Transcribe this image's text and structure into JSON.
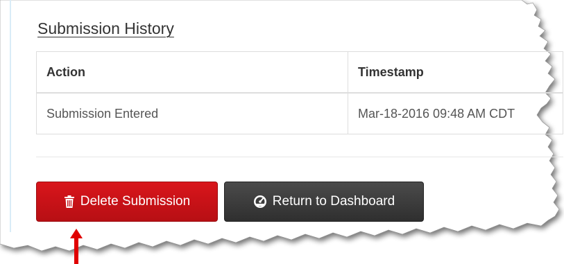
{
  "section": {
    "title": "Submission History"
  },
  "table": {
    "headers": [
      "Action",
      "Timestamp"
    ],
    "rows": [
      [
        "Submission Entered",
        "Mar-18-2016 09:48 AM CDT"
      ]
    ]
  },
  "buttons": {
    "delete_label": "Delete Submission",
    "delete_icon": "trash-icon",
    "return_label": "Return to Dashboard",
    "return_icon": "dashboard-gauge-icon"
  },
  "colors": {
    "delete_button": "#c4131a",
    "return_button": "#3d3d3d",
    "arrow": "#e00000"
  }
}
